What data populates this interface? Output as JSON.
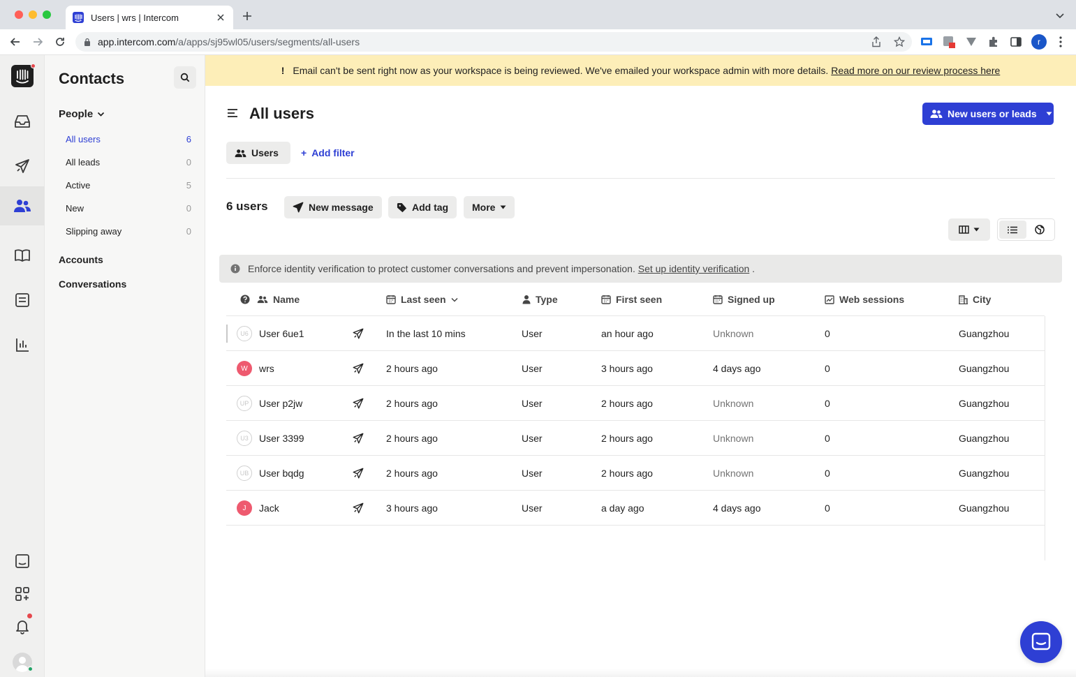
{
  "browser": {
    "tab_title": "Users | wrs | Intercom",
    "url_host": "app.intercom.com",
    "url_path": "/a/apps/sj95wl05/users/segments/all-users",
    "profile_initial": "r"
  },
  "banner": {
    "icon": "!",
    "message": "Email can't be sent right now as your workspace is being reviewed. We've emailed your workspace admin with more details.",
    "link": "Read more on our review process here",
    "color": "#fdeeb8"
  },
  "sidebar": {
    "title": "Contacts",
    "people_label": "People",
    "items": [
      {
        "label": "All users",
        "count": "6"
      },
      {
        "label": "All leads",
        "count": "0"
      },
      {
        "label": "Active",
        "count": "5"
      },
      {
        "label": "New",
        "count": "0"
      },
      {
        "label": "Slipping away",
        "count": "0"
      }
    ],
    "accounts_label": "Accounts",
    "conversations_label": "Conversations"
  },
  "header": {
    "title": "All users",
    "primary_button": "New users or leads",
    "accent": "#2e3fd4"
  },
  "filters": {
    "chip": "Users",
    "add_filter": "Add filter",
    "add_filter_plus": "+"
  },
  "list_toolbar": {
    "count": "6 users",
    "new_message": "New message",
    "add_tag": "Add tag",
    "more": "More"
  },
  "identity_bar": {
    "message": "Enforce identity verification to protect customer conversations and prevent impersonation.",
    "link": "Set up identity verification",
    "trailing": "."
  },
  "table": {
    "columns": [
      "Name",
      "Last seen",
      "Type",
      "First seen",
      "Signed up",
      "Web sessions",
      "City"
    ],
    "rows": [
      {
        "initials": "U6",
        "avatar": "gray",
        "name": "User 6ue1",
        "last_seen": "In the last 10 mins",
        "type": "User",
        "first_seen": "an hour ago",
        "signed_up": "Unknown",
        "web_sessions": "0",
        "city": "Guangzhou"
      },
      {
        "initials": "W",
        "avatar": "red",
        "name": "wrs",
        "last_seen": "2 hours ago",
        "type": "User",
        "first_seen": "3 hours ago",
        "signed_up": "4 days ago",
        "web_sessions": "0",
        "city": "Guangzhou"
      },
      {
        "initials": "UP",
        "avatar": "gray",
        "name": "User p2jw",
        "last_seen": "2 hours ago",
        "type": "User",
        "first_seen": "2 hours ago",
        "signed_up": "Unknown",
        "web_sessions": "0",
        "city": "Guangzhou"
      },
      {
        "initials": "U3",
        "avatar": "gray",
        "name": "User 3399",
        "last_seen": "2 hours ago",
        "type": "User",
        "first_seen": "2 hours ago",
        "signed_up": "Unknown",
        "web_sessions": "0",
        "city": "Guangzhou"
      },
      {
        "initials": "UB",
        "avatar": "gray",
        "name": "User bqdg",
        "last_seen": "2 hours ago",
        "type": "User",
        "first_seen": "2 hours ago",
        "signed_up": "Unknown",
        "web_sessions": "0",
        "city": "Guangzhou"
      },
      {
        "initials": "J",
        "avatar": "red",
        "name": "Jack",
        "last_seen": "3 hours ago",
        "type": "User",
        "first_seen": "a day ago",
        "signed_up": "4 days ago",
        "web_sessions": "0",
        "city": "Guangzhou"
      }
    ]
  },
  "icons": {
    "rail": [
      "intercom-logo-icon",
      "inbox-icon",
      "outbound-icon",
      "contacts-icon",
      "articles-icon",
      "reports-inbox-icon",
      "reports-icon",
      "messenger-settings-icon",
      "apps-icon",
      "notifications-icon",
      "avatar"
    ],
    "row_action": "send-message-icon"
  }
}
